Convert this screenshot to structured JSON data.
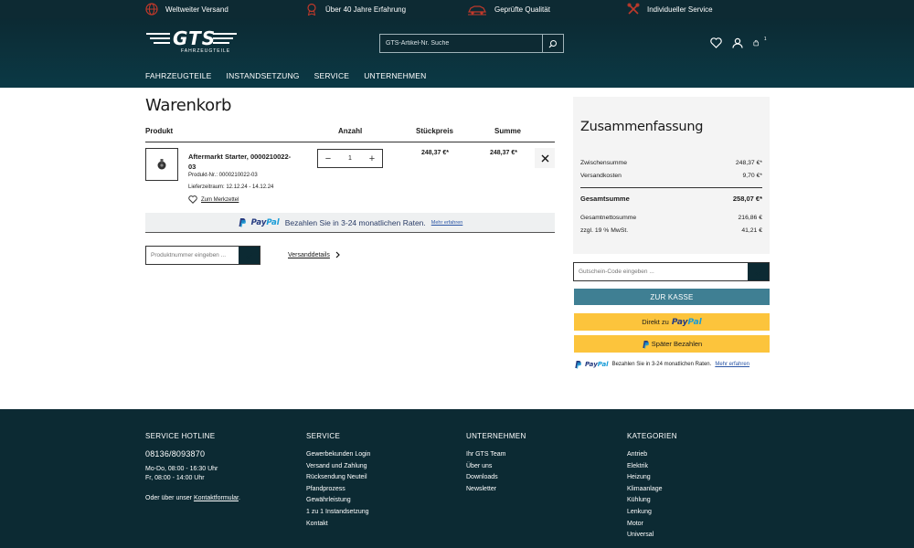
{
  "topbar": {
    "usps": [
      {
        "icon": "globe-icon",
        "label": "Weltweiter Versand"
      },
      {
        "icon": "award-icon",
        "label": "Über 40 Jahre Erfahrung"
      },
      {
        "icon": "car-quality-icon",
        "label": "Geprüfte Qualität"
      },
      {
        "icon": "tools-icon",
        "label": "Individueller Service"
      }
    ],
    "accent": "#c0392b"
  },
  "header": {
    "logo_text": "GTS",
    "logo_sub": "FAHRZEUGTEILE",
    "search_placeholder": "GTS-Artikel-Nr. Suche",
    "cart_count": "1",
    "nav": [
      "FAHRZEUGTEILE",
      "INSTANDSETZUNG",
      "SERVICE",
      "UNTERNEHMEN"
    ]
  },
  "cart": {
    "title": "Warenkorb",
    "columns": {
      "product": "Produkt",
      "qty": "Anzahl",
      "unit": "Stückpreis",
      "sum": "Summe"
    },
    "item": {
      "name": "Aftermarkt Starter, 0000210022-03",
      "product_nr": "Produkt-Nr.: 0000210022-03",
      "delivery": "Lieferzeitraum: 12.12.24 - 14.12.24",
      "wishlist": "Zum Merkzettel",
      "quantity": "1",
      "unit_price": "248,37 €*",
      "total_price": "248,37 €*"
    },
    "paypal_banner": {
      "text": "Bezahlen Sie in 3-24 monatlichen Raten.",
      "more": "Mehr erfahren"
    },
    "product_input_placeholder": "Produktnummer eingeben ...",
    "shipping_link": "Versanddetails"
  },
  "summary": {
    "title": "Zusammenfassung",
    "subtotal_label": "Zwischensumme",
    "subtotal": "248,37 €*",
    "shipping_label": "Versandkosten",
    "shipping": "9,70 €*",
    "total_label": "Gesamtsumme",
    "total": "258,07 €*",
    "net_label": "Gesamtnettosumme",
    "net": "216,86 €",
    "vat_label": "zzgl. 19 % MwSt.",
    "vat": "41,21 €",
    "coupon_placeholder": "Gutschein-Code eingeben ...",
    "checkout": "ZUR KASSE",
    "paypal_direct": "Direkt zu",
    "paypal_later": "Später Bezahlen",
    "paypal_note": "Bezahlen Sie in 3-24 monatlichen Raten.",
    "paypal_note_more": "Mehr erfahren"
  },
  "brand": {
    "paypal_a": "Pay",
    "paypal_b": "Pal"
  },
  "footer": {
    "hotline_title": "SERVICE HOTLINE",
    "phone": "08136/8093870",
    "hours1": "Mo-Do, 08:00 - 16:30 Uhr",
    "hours2": "Fr, 08:00 - 14:00 Uhr",
    "contact_prefix": "Oder über unser",
    "contact_link": "Kontaktformular",
    "service_title": "SERVICE",
    "service_links": [
      "Gewerbekunden Login",
      "Versand und Zahlung",
      "Rücksendung Neuteil",
      "Pfandprozess",
      "Gewährleistung",
      "1 zu 1 Instandsetzung",
      "Kontakt"
    ],
    "company_title": "UNTERNEHMEN",
    "company_links": [
      "Ihr GTS Team",
      "Über uns",
      "Downloads",
      "Newsletter"
    ],
    "categories_title": "KATEGORIEN",
    "category_links": [
      "Antrieb",
      "Elektrik",
      "Heizung",
      "Klimaanlage",
      "Kühlung",
      "Lenkung",
      "Motor",
      "Universal"
    ]
  }
}
